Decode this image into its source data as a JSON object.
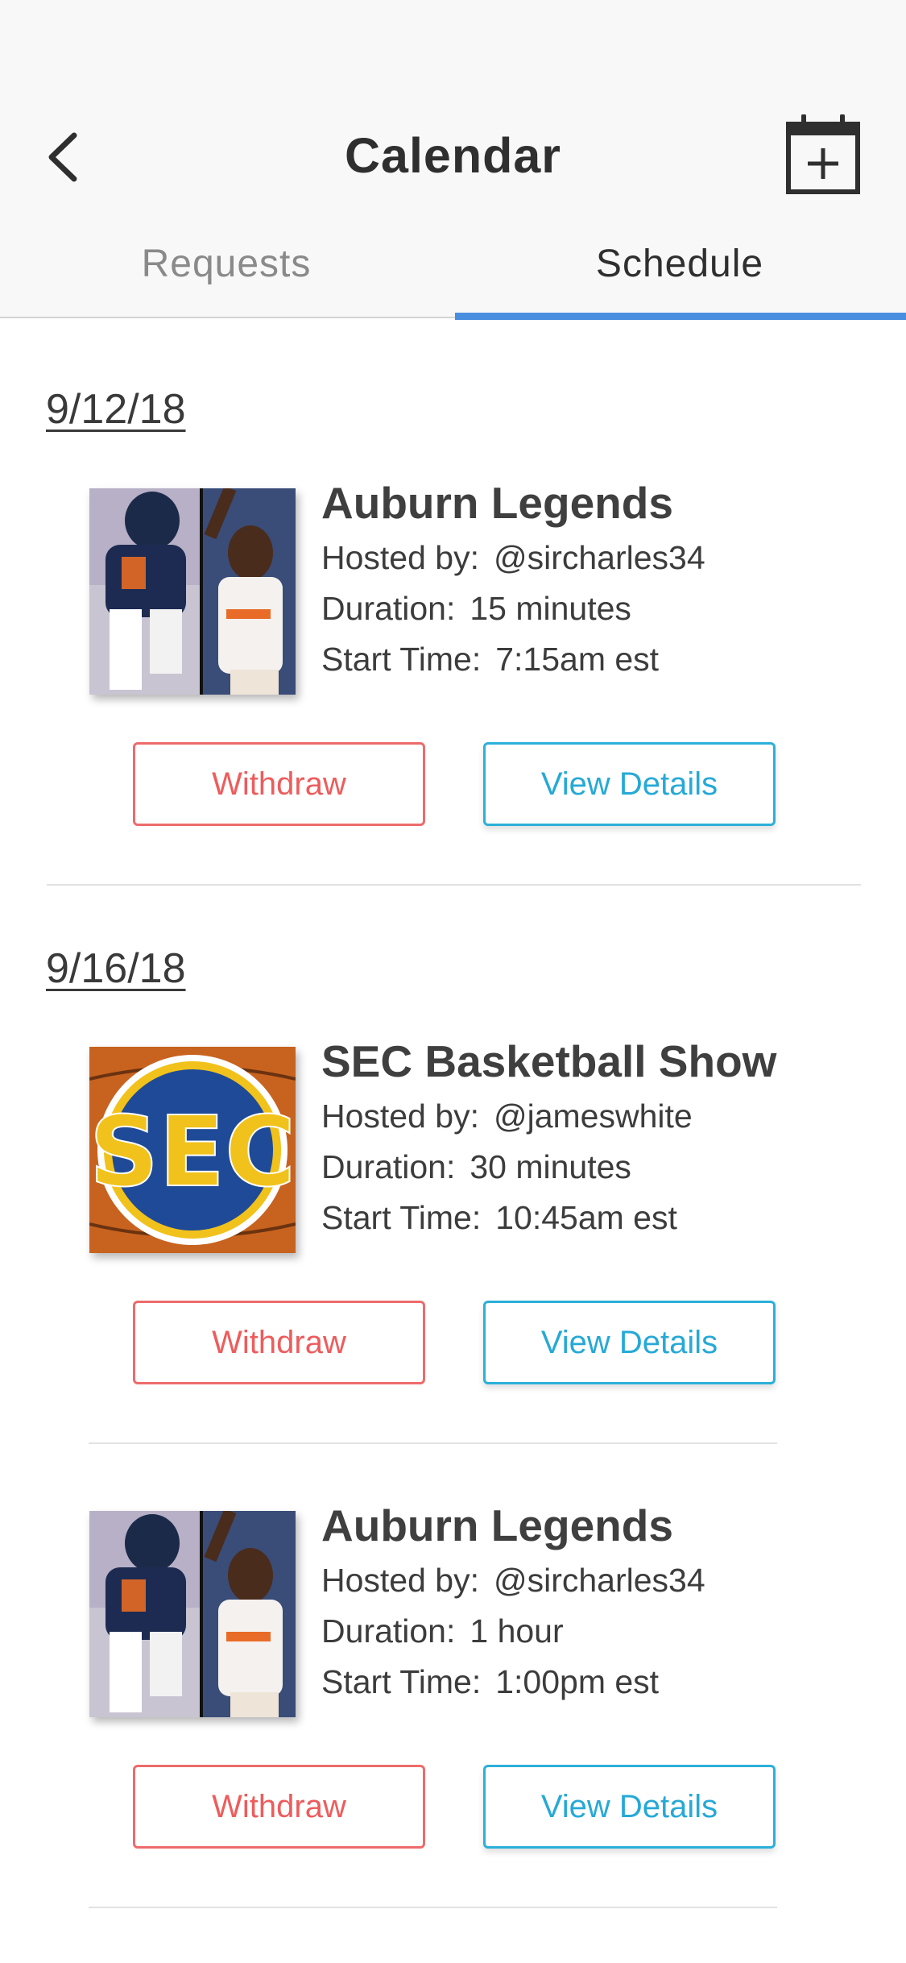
{
  "header": {
    "title": "Calendar",
    "back_icon": "chevron-left-icon",
    "add_icon": "calendar-add-icon"
  },
  "tabs": [
    {
      "label": "Requests",
      "active": false
    },
    {
      "label": "Schedule",
      "active": true
    }
  ],
  "labels": {
    "hosted_by": "Hosted by:",
    "duration": "Duration:",
    "start_time": "Start Time:"
  },
  "colors": {
    "accent": "#4a8ee0",
    "withdraw": "#ee5c5c",
    "view_details": "#26a9d6"
  },
  "groups": [
    {
      "date": "9/12/18",
      "events": [
        {
          "title": "Auburn Legends",
          "host": "@sircharles34",
          "duration": "15 minutes",
          "start_time": "7:15am est",
          "thumbnail": "auburn-legends",
          "withdraw_label": "Withdraw",
          "details_label": "View Details"
        }
      ]
    },
    {
      "date": "9/16/18",
      "events": [
        {
          "title": "SEC Basketball Show",
          "host": "@jameswhite",
          "duration": "30 minutes",
          "start_time": "10:45am est",
          "thumbnail": "sec-logo",
          "withdraw_label": "Withdraw",
          "details_label": "View Details"
        },
        {
          "title": "Auburn Legends",
          "host": "@sircharles34",
          "duration": "1 hour",
          "start_time": "1:00pm est",
          "thumbnail": "auburn-legends",
          "withdraw_label": "Withdraw",
          "details_label": "View Details"
        }
      ]
    }
  ]
}
